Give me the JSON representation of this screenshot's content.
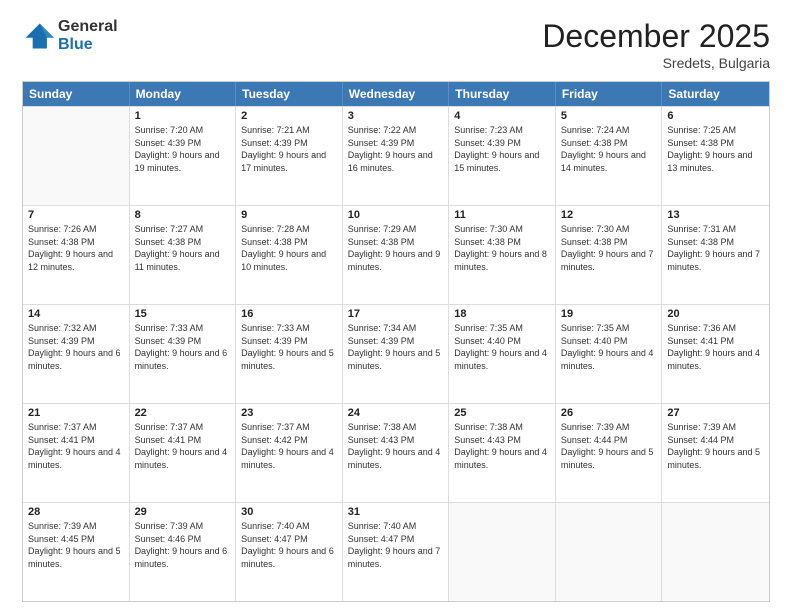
{
  "logo": {
    "general": "General",
    "blue": "Blue"
  },
  "title": "December 2025",
  "subtitle": "Sredets, Bulgaria",
  "header_days": [
    "Sunday",
    "Monday",
    "Tuesday",
    "Wednesday",
    "Thursday",
    "Friday",
    "Saturday"
  ],
  "weeks": [
    [
      {
        "day": "",
        "empty": true
      },
      {
        "day": "1",
        "sunrise": "7:20 AM",
        "sunset": "4:39 PM",
        "daylight": "9 hours and 19 minutes."
      },
      {
        "day": "2",
        "sunrise": "7:21 AM",
        "sunset": "4:39 PM",
        "daylight": "9 hours and 17 minutes."
      },
      {
        "day": "3",
        "sunrise": "7:22 AM",
        "sunset": "4:39 PM",
        "daylight": "9 hours and 16 minutes."
      },
      {
        "day": "4",
        "sunrise": "7:23 AM",
        "sunset": "4:39 PM",
        "daylight": "9 hours and 15 minutes."
      },
      {
        "day": "5",
        "sunrise": "7:24 AM",
        "sunset": "4:38 PM",
        "daylight": "9 hours and 14 minutes."
      },
      {
        "day": "6",
        "sunrise": "7:25 AM",
        "sunset": "4:38 PM",
        "daylight": "9 hours and 13 minutes."
      }
    ],
    [
      {
        "day": "7",
        "sunrise": "7:26 AM",
        "sunset": "4:38 PM",
        "daylight": "9 hours and 12 minutes."
      },
      {
        "day": "8",
        "sunrise": "7:27 AM",
        "sunset": "4:38 PM",
        "daylight": "9 hours and 11 minutes."
      },
      {
        "day": "9",
        "sunrise": "7:28 AM",
        "sunset": "4:38 PM",
        "daylight": "9 hours and 10 minutes."
      },
      {
        "day": "10",
        "sunrise": "7:29 AM",
        "sunset": "4:38 PM",
        "daylight": "9 hours and 9 minutes."
      },
      {
        "day": "11",
        "sunrise": "7:30 AM",
        "sunset": "4:38 PM",
        "daylight": "9 hours and 8 minutes."
      },
      {
        "day": "12",
        "sunrise": "7:30 AM",
        "sunset": "4:38 PM",
        "daylight": "9 hours and 7 minutes."
      },
      {
        "day": "13",
        "sunrise": "7:31 AM",
        "sunset": "4:38 PM",
        "daylight": "9 hours and 7 minutes."
      }
    ],
    [
      {
        "day": "14",
        "sunrise": "7:32 AM",
        "sunset": "4:39 PM",
        "daylight": "9 hours and 6 minutes."
      },
      {
        "day": "15",
        "sunrise": "7:33 AM",
        "sunset": "4:39 PM",
        "daylight": "9 hours and 6 minutes."
      },
      {
        "day": "16",
        "sunrise": "7:33 AM",
        "sunset": "4:39 PM",
        "daylight": "9 hours and 5 minutes."
      },
      {
        "day": "17",
        "sunrise": "7:34 AM",
        "sunset": "4:39 PM",
        "daylight": "9 hours and 5 minutes."
      },
      {
        "day": "18",
        "sunrise": "7:35 AM",
        "sunset": "4:40 PM",
        "daylight": "9 hours and 4 minutes."
      },
      {
        "day": "19",
        "sunrise": "7:35 AM",
        "sunset": "4:40 PM",
        "daylight": "9 hours and 4 minutes."
      },
      {
        "day": "20",
        "sunrise": "7:36 AM",
        "sunset": "4:41 PM",
        "daylight": "9 hours and 4 minutes."
      }
    ],
    [
      {
        "day": "21",
        "sunrise": "7:37 AM",
        "sunset": "4:41 PM",
        "daylight": "9 hours and 4 minutes."
      },
      {
        "day": "22",
        "sunrise": "7:37 AM",
        "sunset": "4:41 PM",
        "daylight": "9 hours and 4 minutes."
      },
      {
        "day": "23",
        "sunrise": "7:37 AM",
        "sunset": "4:42 PM",
        "daylight": "9 hours and 4 minutes."
      },
      {
        "day": "24",
        "sunrise": "7:38 AM",
        "sunset": "4:43 PM",
        "daylight": "9 hours and 4 minutes."
      },
      {
        "day": "25",
        "sunrise": "7:38 AM",
        "sunset": "4:43 PM",
        "daylight": "9 hours and 4 minutes."
      },
      {
        "day": "26",
        "sunrise": "7:39 AM",
        "sunset": "4:44 PM",
        "daylight": "9 hours and 5 minutes."
      },
      {
        "day": "27",
        "sunrise": "7:39 AM",
        "sunset": "4:44 PM",
        "daylight": "9 hours and 5 minutes."
      }
    ],
    [
      {
        "day": "28",
        "sunrise": "7:39 AM",
        "sunset": "4:45 PM",
        "daylight": "9 hours and 5 minutes."
      },
      {
        "day": "29",
        "sunrise": "7:39 AM",
        "sunset": "4:46 PM",
        "daylight": "9 hours and 6 minutes."
      },
      {
        "day": "30",
        "sunrise": "7:40 AM",
        "sunset": "4:47 PM",
        "daylight": "9 hours and 6 minutes."
      },
      {
        "day": "31",
        "sunrise": "7:40 AM",
        "sunset": "4:47 PM",
        "daylight": "9 hours and 7 minutes."
      },
      {
        "day": "",
        "empty": true
      },
      {
        "day": "",
        "empty": true
      },
      {
        "day": "",
        "empty": true
      }
    ]
  ]
}
